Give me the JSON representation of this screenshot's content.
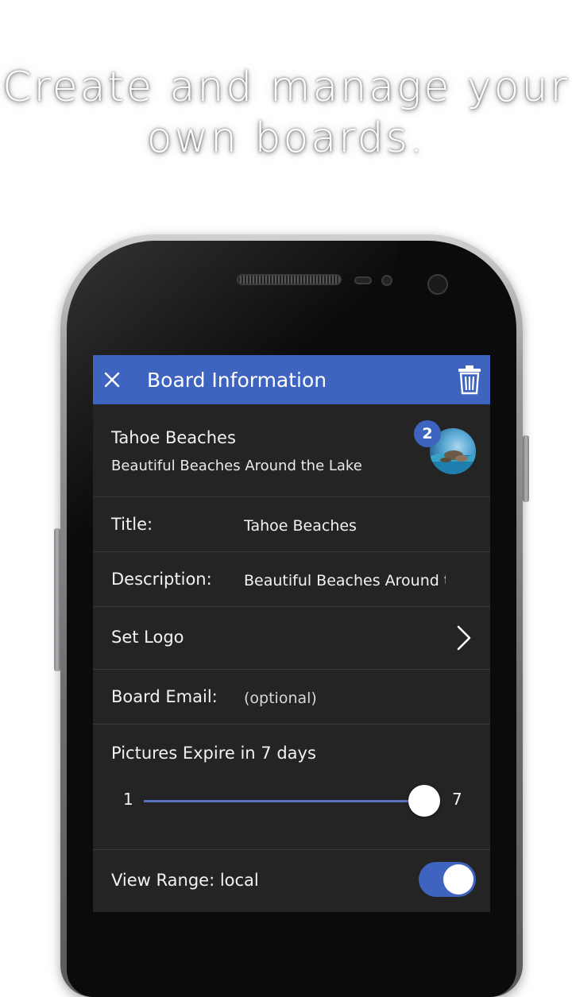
{
  "headline": {
    "line1": "Create and manage your",
    "line2": "own boards."
  },
  "appbar": {
    "title": "Board Information",
    "close_icon": "close-icon",
    "delete_icon": "trash-icon",
    "color": "#3e64c0"
  },
  "board": {
    "name": "Tahoe Beaches",
    "subtitle": "Beautiful Beaches Around the Lake",
    "badge_count": "2"
  },
  "fields": {
    "title_label": "Title:",
    "title_value": "Tahoe Beaches",
    "description_label": "Description:",
    "description_value": "Beautiful Beaches Around the Lake",
    "logo_label": "Set Logo",
    "email_label": "Board Email:",
    "email_placeholder": "(optional)"
  },
  "expire": {
    "label": "Pictures Expire in 7 days",
    "min": "1",
    "max": "7",
    "value": 7
  },
  "view_range": {
    "label": "View Range: local",
    "enabled": true
  }
}
